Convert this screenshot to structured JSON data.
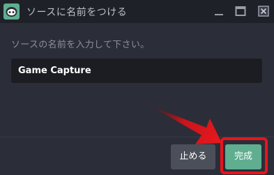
{
  "window": {
    "title": "ソースに名前をつける"
  },
  "dialog": {
    "prompt": "ソースの名前を入力して下さい。",
    "name_value": "Game Capture"
  },
  "buttons": {
    "stop_label": "止める",
    "done_label": "完成"
  },
  "colors": {
    "titlebar": "#1f2128",
    "background": "#2b2e38",
    "input_bg": "#1b1d23",
    "accent": "#5fae90",
    "highlight": "#e8151c"
  },
  "icons": [
    "app-logo-icon",
    "minimize-icon",
    "maximize-icon",
    "close-icon",
    "annotation-arrow"
  ]
}
